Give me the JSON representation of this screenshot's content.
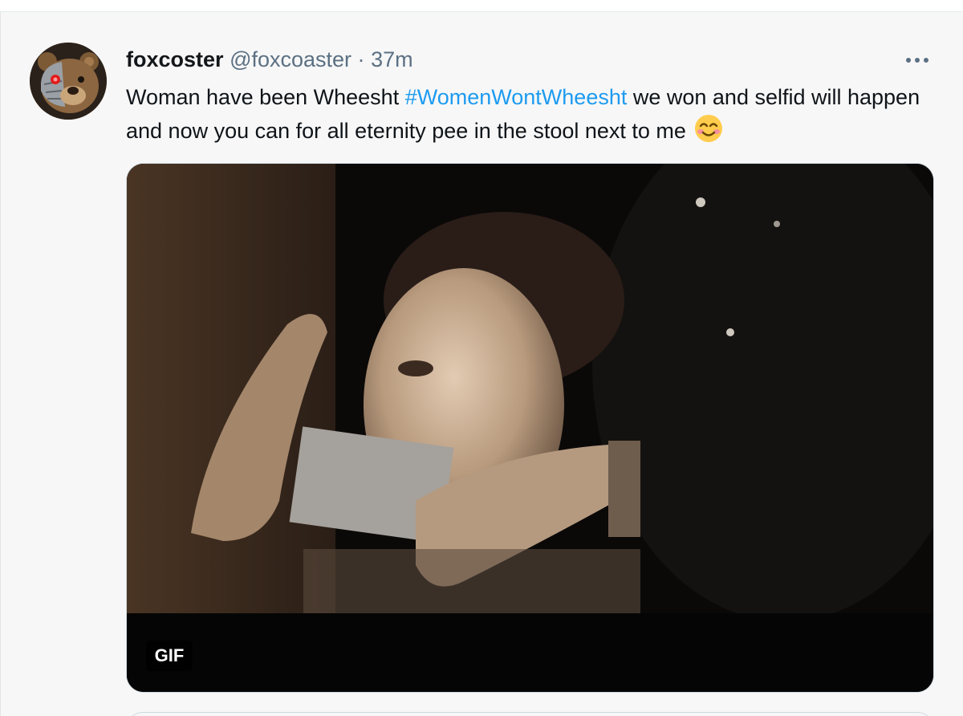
{
  "tweet": {
    "display_name": "foxcoster",
    "handle": "@foxcoaster",
    "separator": "·",
    "timestamp": "37m",
    "text_before": "Woman have been Wheesht ",
    "hashtag": "#WomenWontWheesht",
    "text_after": " we won and selfid will happen and now you can for all eternity pee in the stool next to me",
    "emoji": "smiling-face-with-smiling-eyes-icon",
    "media_badge": "GIF"
  },
  "colors": {
    "hashtag": "#1d9bf0",
    "secondary_text": "#5b7083",
    "background": "#f7f7f7"
  }
}
